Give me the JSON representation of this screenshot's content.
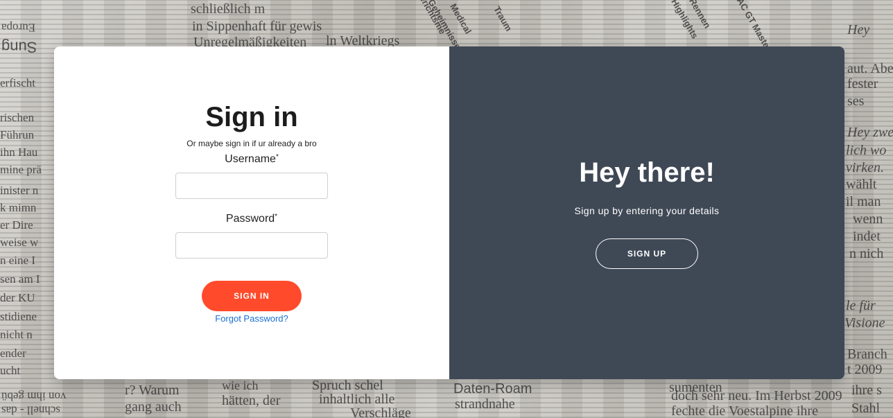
{
  "signin": {
    "title": "Sign in",
    "subtitle": "Or maybe sign in if ur already a bro",
    "username_label": "Username",
    "password_label": "Password",
    "required_mark": "*",
    "username_value": "",
    "password_value": "",
    "button_label": "SIGN IN",
    "forgot_label": "Forgot Password?"
  },
  "signup": {
    "title": "Hey there!",
    "subtitle": "Sign up by entering your details",
    "button_label": "SIGN UP"
  },
  "background": {
    "fragments": [
      "schließlich m",
      "in Sippenhaft für gewis",
      "Unregelmäßigkeiten",
      "ln Weltkriegs",
      "Gerichtsme",
      "Geheimnisse",
      "Highlights",
      "Rennen",
      "ADAC GT Master",
      "Medical",
      "Traum",
      "Hey zwei",
      "lich wo",
      "virken.",
      "wählt",
      "il man",
      "wenn",
      "indet",
      "n nich",
      "le für",
      "Visione",
      "Branch",
      "t 2009",
      "ihre s",
      "Stahl",
      "wie ich",
      "Spruch schel",
      "hätten, der",
      "inhaltlich alle",
      "Daten-Roam",
      "strandnahe",
      "Verschläge",
      "sumenten",
      "doch sehr neu. Im Herbst 2009",
      "fechte die Voestalpine ihre",
      "r? Warum",
      "gang auch",
      "von ihm gebü",
      "schnell - das",
      "Sung",
      "Europa",
      "erfischt",
      "rischen",
      "Führun",
      "ihn Hau",
      "mine prä",
      "inister n",
      "k mimn",
      "er Dire",
      "weise w",
      "n eine I",
      "sen am I",
      "der KU",
      "stidiene",
      "nicht n",
      "ender",
      "ucht",
      "aut. Abe",
      "fester",
      "ses",
      "Hey"
    ]
  }
}
